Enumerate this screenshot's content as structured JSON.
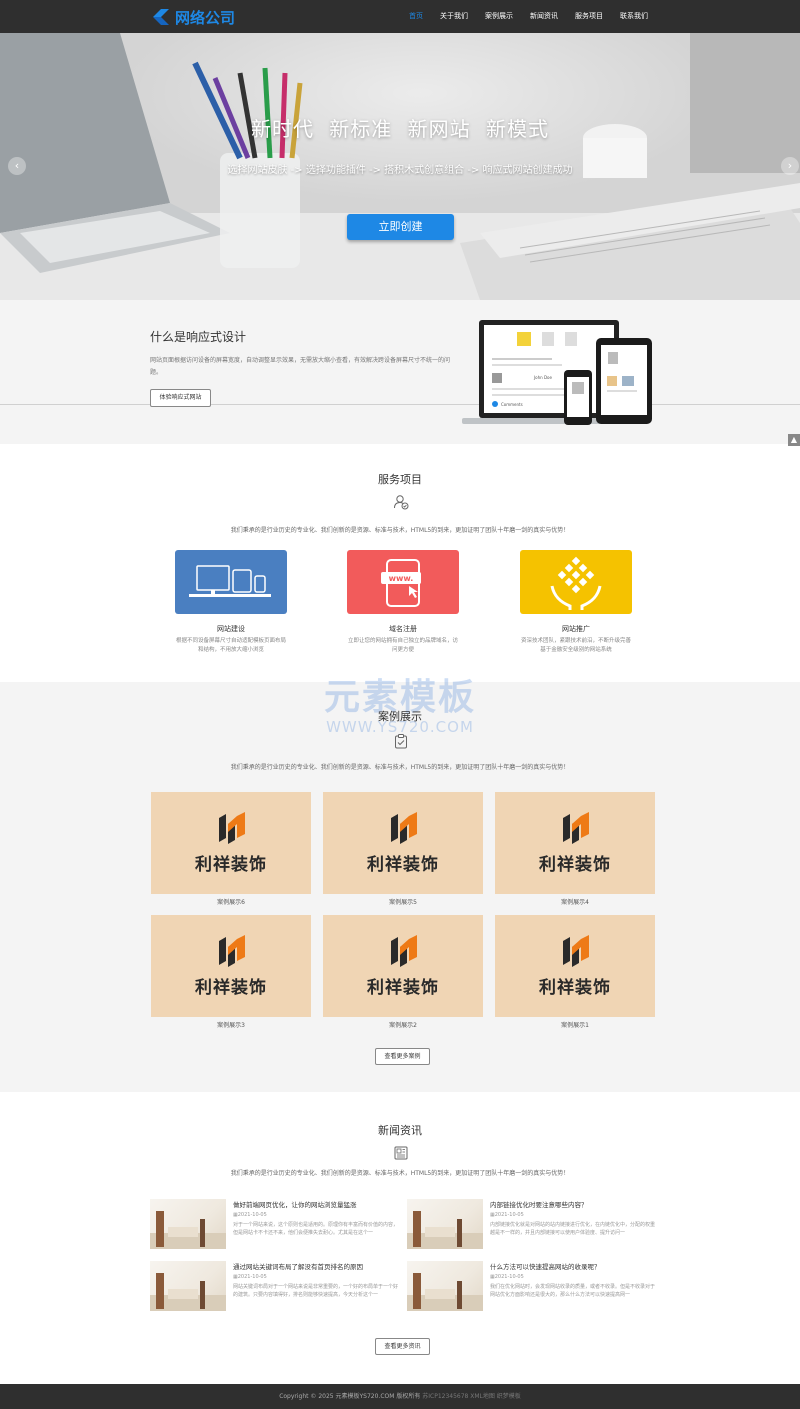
{
  "header": {
    "logo_text": "网络公司",
    "nav": [
      {
        "label": "首页",
        "active": true
      },
      {
        "label": "关于我们",
        "active": false
      },
      {
        "label": "案例展示",
        "active": false
      },
      {
        "label": "新闻资讯",
        "active": false
      },
      {
        "label": "服务项目",
        "active": false
      },
      {
        "label": "联系我们",
        "active": false
      }
    ]
  },
  "hero": {
    "title": "新时代 新标准 新网站 新模式",
    "subtitle": "选择网站皮肤 -> 选择功能插件 -> 搭积木式创意组合 -> 响应式网站创建成功",
    "button": "立即创建",
    "prev_icon": "chevron-left-icon",
    "next_icon": "chevron-right-icon"
  },
  "responsive": {
    "title": "什么是响应式设计",
    "desc": "网站页面根据访问设备的屏幕宽度，自动调整显示效果，无需放大缩小查看，有效解决跨设备屏幕尺寸不统一的问题。",
    "button": "体验响应式网站",
    "device_labels": {
      "author": "John Doe",
      "comments": "Comments"
    }
  },
  "services": {
    "title": "服务项目",
    "desc": "我们秉承的是行业历史的专业化、我们创新的是资源、标准与技术，HTML5的到来，更加证明了团队十年磨一剑的真实与优势！",
    "items": [
      {
        "name": "网站建设",
        "desc": "根据不同设备屏幕尺寸自动适配模板页面布局和结构，不用放大缩小浏览",
        "color": "#4a7fc1",
        "icon": "devices-icon"
      },
      {
        "name": "域名注册",
        "desc": "立即让您的网站拥有自己独立的品牌域名，访问更方便",
        "color": "#f25b5b",
        "icon": "www-phone-icon",
        "badge": "www."
      },
      {
        "name": "网站推广",
        "desc": "资深技术团队，紧跟技术前沿，不断升级完善基于金融安全级别的网站系统",
        "color": "#f5c200",
        "icon": "hands-diamond-icon"
      }
    ]
  },
  "watermark": {
    "line1": "元素模板",
    "line2": "WWW.YS720.COM"
  },
  "cases": {
    "title": "案例展示",
    "desc": "我们秉承的是行业历史的专业化、我们创新的是资源、标准与技术，HTML5的到来，更加证明了团队十年磨一剑的真实与优势！",
    "logo_text": "利祥装饰",
    "items": [
      {
        "label": "案例展示6"
      },
      {
        "label": "案例展示5"
      },
      {
        "label": "案例展示4"
      },
      {
        "label": "案例展示3"
      },
      {
        "label": "案例展示2"
      },
      {
        "label": "案例展示1"
      }
    ],
    "more": "查看更多案例"
  },
  "news": {
    "title": "新闻资讯",
    "desc": "我们秉承的是行业历史的专业化、我们创新的是资源、标准与技术，HTML5的到来，更加证明了团队十年磨一剑的真实与优势！",
    "items": [
      {
        "title": "做好前端网页优化，让你的网站浏览量猛涨",
        "date": "2021-10-05",
        "text": "对于一个网站来说，这个原则也是适用的。原理你有丰富而有价值的内容，但是网站卡不卡还不来，他们会便推失去耐心。尤其是在这个一"
      },
      {
        "title": "内部链接优化时要注意哪些内容？",
        "date": "2021-10-05",
        "text": "内部链接优化就是对网站的站内链接进行优化，在内链优化中，分配的权重越是不一样的，并且内部链接可以使用户体验度、提升访问一"
      },
      {
        "title": "通过网站关键词布局了解没有首页排名的原因",
        "date": "2021-10-05",
        "text": "网站关键词布局对于一个网站来说是非常重要的，一个好的布局单于一个好的建筑。只要内容填得好，排名则能够快速提高，今天分析这个一"
      },
      {
        "title": "什么方法可以快速提高网站的收录呢？",
        "date": "2021-10-05",
        "text": "我们在优化网站时，会发现网站收录的质量，或者不收录。但是不收录对于网站优化方面影响还是很大的，那么什么方法可以快速提高网一"
      }
    ],
    "more": "查看更多资讯"
  },
  "footer": {
    "main": "Copyright © 2025 元素模板YS720.COM 版权所有",
    "dim": " 苏ICP12345678 XML地图 织梦模板"
  }
}
